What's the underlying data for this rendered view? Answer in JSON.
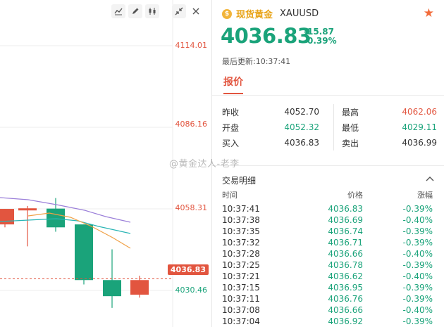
{
  "toolbar": {
    "icons": [
      "line-chart-icon",
      "pen-icon",
      "candlestick-icon",
      "compress-icon",
      "close-icon"
    ]
  },
  "chart": {
    "price_labels": [
      "4114.01",
      "4086.16",
      "4058.31",
      "4030.46"
    ],
    "current_price_tag": "4036.83",
    "colors": {
      "up": "#1aa37a",
      "down": "#e2553f",
      "ma_purple": "#9b7fd9",
      "ma_teal": "#2ab5b5",
      "ma_orange": "#f0a045"
    }
  },
  "chart_data": {
    "type": "candlestick",
    "ylim": [
      4030.46,
      4114.01
    ],
    "candles": [
      {
        "open": 4058.3,
        "close": 4053.0,
        "high": 4058.3,
        "low": 4052.0,
        "color": "down"
      },
      {
        "open": 4058.5,
        "close": 4057.8,
        "high": 4059.3,
        "low": 4045.5,
        "color": "down"
      },
      {
        "open": 4052.0,
        "close": 4058.4,
        "high": 4062.0,
        "low": 4050.5,
        "color": "up"
      },
      {
        "open": 4053.0,
        "close": 4034.0,
        "high": 4053.0,
        "low": 4032.5,
        "color": "up"
      },
      {
        "open": 4034.0,
        "close": 4028.5,
        "high": 4044.5,
        "low": 4024.5,
        "color": "up"
      },
      {
        "open": 4034.0,
        "close": 4029.0,
        "high": 4035.5,
        "low": 4028.0,
        "color": "down"
      }
    ]
  },
  "quote": {
    "name": "现货黄金",
    "symbol": "XAUUSD",
    "price": "4036.83",
    "change_abs": "-15.87",
    "change_pct": "-0.39%",
    "updated_label": "最后更新:",
    "updated_time": "10:37:41",
    "tab": "报价",
    "stats": [
      {
        "l": "昨收",
        "v": "4052.70",
        "vc": "dark",
        "l2": "最高",
        "v2": "4062.06",
        "v2c": "red"
      },
      {
        "l": "开盘",
        "v": "4052.32",
        "vc": "green",
        "l2": "最低",
        "v2": "4029.11",
        "v2c": "green"
      },
      {
        "l": "买入",
        "v": "4036.83",
        "vc": "dark",
        "l2": "卖出",
        "v2": "4036.99",
        "v2c": "dark"
      }
    ]
  },
  "trades": {
    "title": "交易明细",
    "headers": {
      "time": "时间",
      "price": "价格",
      "change": "涨幅"
    },
    "rows": [
      {
        "t": "10:37:41",
        "p": "4036.83",
        "c": "-0.39%"
      },
      {
        "t": "10:37:38",
        "p": "4036.69",
        "c": "-0.40%"
      },
      {
        "t": "10:37:35",
        "p": "4036.74",
        "c": "-0.39%"
      },
      {
        "t": "10:37:32",
        "p": "4036.71",
        "c": "-0.39%"
      },
      {
        "t": "10:37:28",
        "p": "4036.66",
        "c": "-0.40%"
      },
      {
        "t": "10:37:25",
        "p": "4036.78",
        "c": "-0.39%"
      },
      {
        "t": "10:37:21",
        "p": "4036.62",
        "c": "-0.40%"
      },
      {
        "t": "10:37:15",
        "p": "4036.95",
        "c": "-0.39%"
      },
      {
        "t": "10:37:11",
        "p": "4036.76",
        "c": "-0.39%"
      },
      {
        "t": "10:37:08",
        "p": "4036.66",
        "c": "-0.40%"
      },
      {
        "t": "10:37:04",
        "p": "4036.92",
        "c": "-0.39%"
      }
    ]
  },
  "watermark": "@黄金达人-老李"
}
